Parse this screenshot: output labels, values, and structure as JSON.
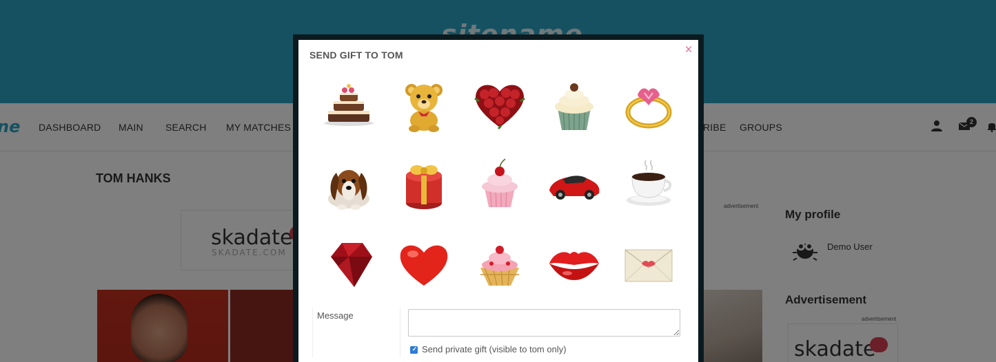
{
  "site": {
    "logo_text": "sitename",
    "nav_logo_fragment": "ne",
    "nav": [
      "DASHBOARD",
      "MAIN",
      "SEARCH",
      "MY MATCHES",
      "RIBE",
      "GROUPS"
    ],
    "mail_badge_count": "2"
  },
  "profile": {
    "name": "TOM HANKS"
  },
  "ads": {
    "label": "advertisement",
    "brand": "skadate",
    "brand_sub": "SKADATE.COM"
  },
  "sidebar": {
    "my_profile_title": "My profile",
    "user_name": "Demo User",
    "advertisement_title": "Advertisement"
  },
  "modal": {
    "title": "SEND GIFT TO TOM",
    "close_symbol": "×",
    "gifts": [
      {
        "name": "cake"
      },
      {
        "name": "teddy-bear"
      },
      {
        "name": "rose-heart"
      },
      {
        "name": "cupcake-cream"
      },
      {
        "name": "ring"
      },
      {
        "name": "dog"
      },
      {
        "name": "gift-box"
      },
      {
        "name": "cupcake-cherry"
      },
      {
        "name": "sports-car"
      },
      {
        "name": "coffee-cup"
      },
      {
        "name": "ruby"
      },
      {
        "name": "heart"
      },
      {
        "name": "ice-cream"
      },
      {
        "name": "lips"
      },
      {
        "name": "envelope"
      }
    ],
    "message_label": "Message",
    "message_value": "",
    "private_checked": true,
    "private_label": "Send private gift (visible to tom only)"
  },
  "colors": {
    "header": "#2aa3c2",
    "close": "#e0739c",
    "checkbox": "#2d7bd6",
    "ad_heart": "#d63f52"
  }
}
